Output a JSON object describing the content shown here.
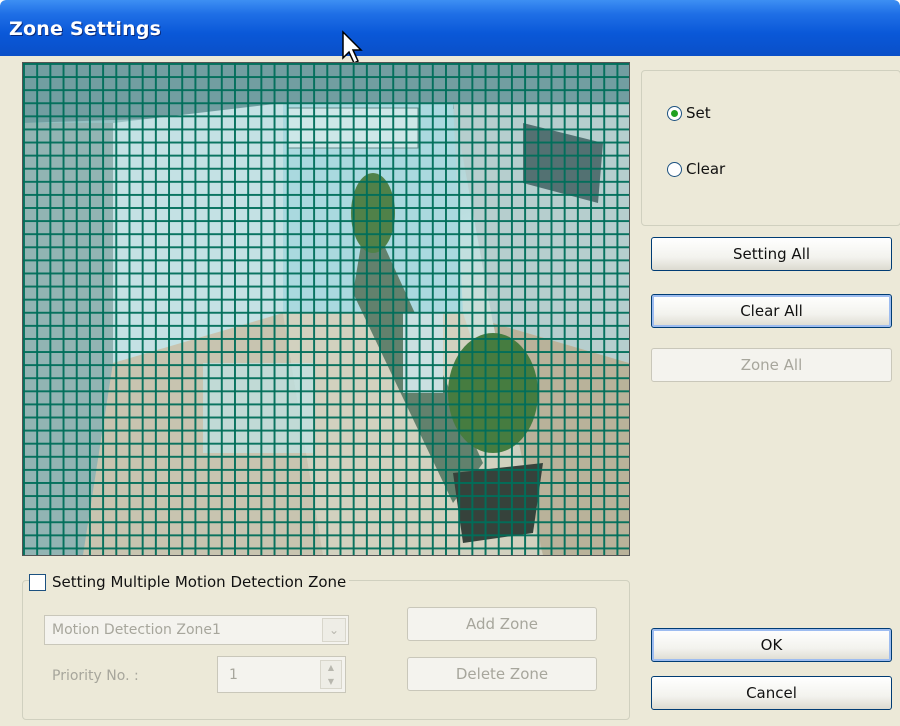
{
  "window": {
    "title": "Zone Settings"
  },
  "mode": {
    "options": [
      {
        "label": "Set",
        "selected": true
      },
      {
        "label": "Clear",
        "selected": false
      }
    ]
  },
  "buttons": {
    "setting_all": "Setting All",
    "clear_all": "Clear All",
    "zone_all": "Zone All",
    "add_zone": "Add Zone",
    "delete_zone": "Delete Zone",
    "ok": "OK",
    "cancel": "Cancel"
  },
  "multi_zone": {
    "checkbox_label": "Setting Multiple Motion Detection Zone",
    "checked": false,
    "zone_select_value": "Motion Detection Zone1",
    "priority_label": "Priority No. :",
    "priority_value": "1"
  },
  "colors": {
    "grid": "#006e5a",
    "titlebar": "#0a58d8",
    "radio_selected": "#21a121"
  }
}
